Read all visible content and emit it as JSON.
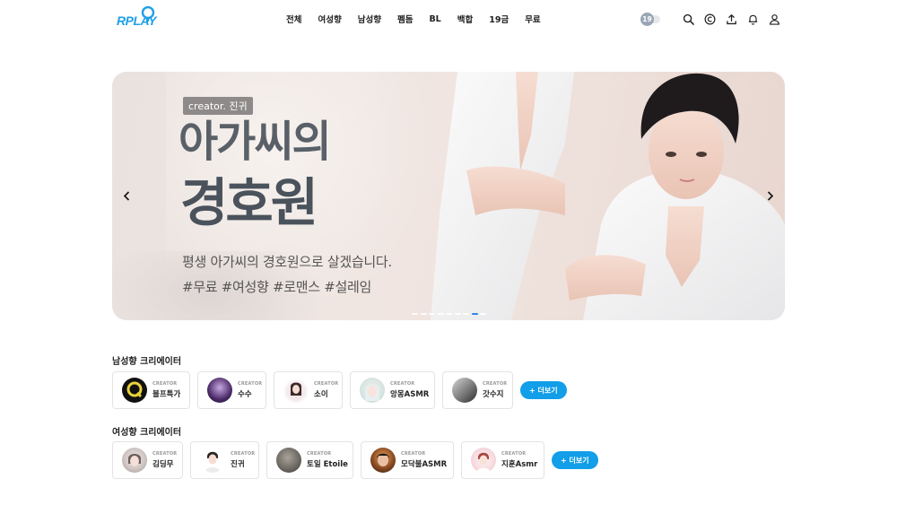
{
  "brand": {
    "logo_text": "RPLAY",
    "accent": "#1fa0e8"
  },
  "nav": {
    "items": [
      "전체",
      "여성향",
      "남성향",
      "펨돔",
      "BL",
      "백합",
      "19금",
      "무료"
    ]
  },
  "toolbar": {
    "adult_toggle_label": "19",
    "icons": [
      "search-icon",
      "coin-icon",
      "upload-icon",
      "bell-icon",
      "user-icon"
    ]
  },
  "banner": {
    "badge": "creator. 진귀",
    "title_line1": "아가씨의",
    "title_line2": "경호원",
    "subtitle": "평생 아가씨의 경호원으로 살겠습니다.",
    "tags": "#무료 #여성향 #로맨스 #설레임",
    "slide_count": 9,
    "active_slide": 8
  },
  "male_section": {
    "title": "남성향 크리에이터",
    "more_label": "+ 더보기",
    "creators": [
      {
        "kicker": "CREATOR",
        "name": "블프특가"
      },
      {
        "kicker": "CREATOR",
        "name": "수수"
      },
      {
        "kicker": "CREATOR",
        "name": "소이"
      },
      {
        "kicker": "CREATOR",
        "name": "앙몽ASMR"
      },
      {
        "kicker": "CREATOR",
        "name": "갓수지"
      }
    ]
  },
  "female_section": {
    "title": "여성향 크리에이터",
    "more_label": "+ 더보기",
    "creators": [
      {
        "kicker": "CREATOR",
        "name": "김딩무"
      },
      {
        "kicker": "CREATOR",
        "name": "진귀"
      },
      {
        "kicker": "CREATOR",
        "name": "토일 Etoile"
      },
      {
        "kicker": "CREATOR",
        "name": "모닥불ASMR"
      },
      {
        "kicker": "CREATOR",
        "name": "지훈Asmr"
      }
    ]
  }
}
